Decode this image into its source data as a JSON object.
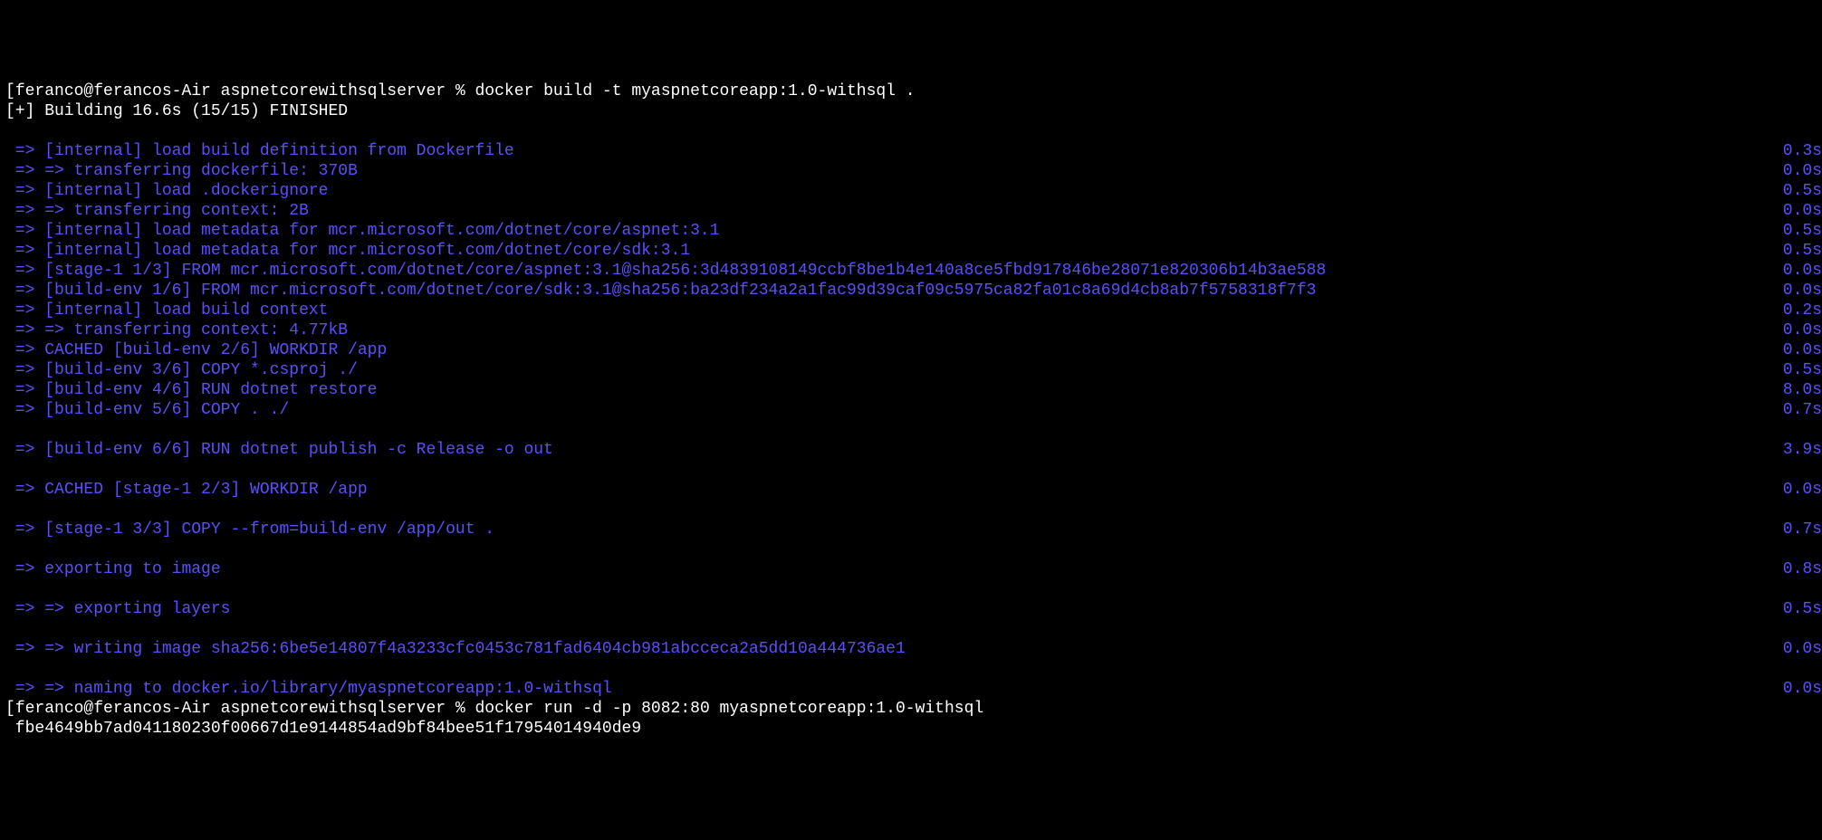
{
  "prompt1": {
    "bracket": "[",
    "userhost": "feranco@ferancos-Air aspnetcorewithsqlserver % ",
    "cmd": "docker build -t myaspnetcoreapp:1.0-withsql ."
  },
  "status": "[+] Building 16.6s (15/15) FINISHED",
  "lines": [
    {
      "arrow": " => ",
      "text": "[internal] load build definition from Dockerfile",
      "time": "0.3s"
    },
    {
      "arrow": " => => ",
      "text": "transferring dockerfile: 370B",
      "time": "0.0s"
    },
    {
      "arrow": " => ",
      "text": "[internal] load .dockerignore",
      "time": "0.5s"
    },
    {
      "arrow": " => => ",
      "text": "transferring context: 2B",
      "time": "0.0s"
    },
    {
      "arrow": " => ",
      "text": "[internal] load metadata for mcr.microsoft.com/dotnet/core/aspnet:3.1",
      "time": "0.5s"
    },
    {
      "arrow": " => ",
      "text": "[internal] load metadata for mcr.microsoft.com/dotnet/core/sdk:3.1",
      "time": "0.5s"
    },
    {
      "arrow": " => ",
      "text": "[stage-1 1/3] FROM mcr.microsoft.com/dotnet/core/aspnet:3.1@sha256:3d4839108149ccbf8be1b4e140a8ce5fbd917846be28071e820306b14b3ae588",
      "time": "0.0s"
    },
    {
      "arrow": " => ",
      "text": "[build-env 1/6] FROM mcr.microsoft.com/dotnet/core/sdk:3.1@sha256:ba23df234a2a1fac99d39caf09c5975ca82fa01c8a69d4cb8ab7f5758318f7f3",
      "time": "0.0s"
    },
    {
      "arrow": " => ",
      "text": "[internal] load build context",
      "time": "0.2s"
    },
    {
      "arrow": " => => ",
      "text": "transferring context: 4.77kB",
      "time": "0.0s"
    },
    {
      "arrow": " => ",
      "text": "CACHED [build-env 2/6] WORKDIR /app",
      "time": "0.0s"
    },
    {
      "arrow": " => ",
      "text": "[build-env 3/6] COPY *.csproj ./",
      "time": "0.5s"
    },
    {
      "arrow": " => ",
      "text": "[build-env 4/6] RUN dotnet restore",
      "time": "8.0s"
    },
    {
      "arrow": " => ",
      "text": "[build-env 5/6] COPY . ./",
      "time": "0.7s"
    },
    {
      "blank": true
    },
    {
      "arrow": " => ",
      "text": "[build-env 6/6] RUN dotnet publish -c Release -o out",
      "time": "3.9s"
    },
    {
      "blank": true
    },
    {
      "arrow": " => ",
      "text": "CACHED [stage-1 2/3] WORKDIR /app",
      "time": "0.0s"
    },
    {
      "blank": true
    },
    {
      "arrow": " => ",
      "text": "[stage-1 3/3] COPY --from=build-env /app/out .",
      "time": "0.7s"
    },
    {
      "blank": true
    },
    {
      "arrow": " => ",
      "text": "exporting to image",
      "time": "0.8s"
    },
    {
      "blank": true
    },
    {
      "arrow": " => => ",
      "text": "exporting layers",
      "time": "0.5s"
    },
    {
      "blank": true
    },
    {
      "arrow": " => => ",
      "text": "writing image sha256:6be5e14807f4a3233cfc0453c781fad6404cb981abcceca2a5dd10a444736ae1",
      "time": "0.0s"
    },
    {
      "blank": true
    },
    {
      "arrow": " => => ",
      "text": "naming to docker.io/library/myaspnetcoreapp:1.0-withsql",
      "time": "0.0s"
    }
  ],
  "prompt2": {
    "bracket": "[",
    "userhost": "feranco@ferancos-Air aspnetcorewithsqlserver % ",
    "cmd": "docker run -d -p 8082:80 myaspnetcoreapp:1.0-withsql"
  },
  "container_id": " fbe4649bb7ad041180230f00667d1e9144854ad9bf84bee51f17954014940de9"
}
